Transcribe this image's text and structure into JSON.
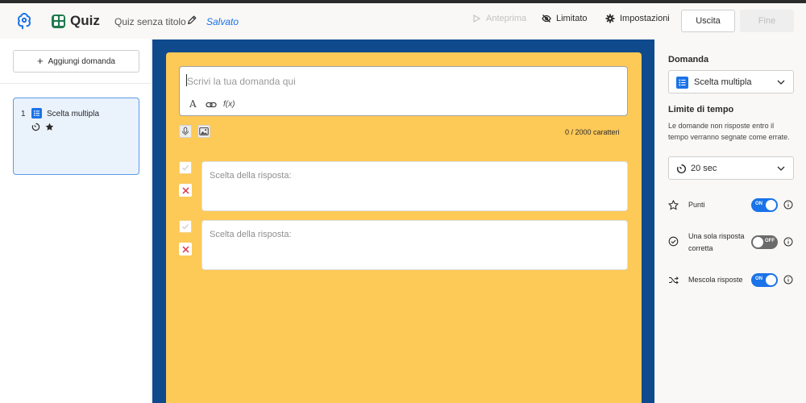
{
  "header": {
    "brand": "Quiz",
    "quiz_title": "Quiz senza titolo",
    "save_status": "Salvato",
    "preview_label": "Anteprima",
    "visibility_label": "Limitato",
    "settings_label": "Impostazioni",
    "exit_label": "Uscita",
    "done_label": "Fine"
  },
  "sidebar": {
    "add_question_label": "Aggiungi domanda",
    "questions": [
      {
        "number": "1",
        "type_label": "Scelta multipla"
      }
    ]
  },
  "editor": {
    "question_placeholder": "Scrivi la tua domanda qui",
    "format_text": "A",
    "format_formula": "f(x)",
    "char_count": "0 / 2000 caratteri",
    "answers": [
      {
        "placeholder": "Scelta della risposta:"
      },
      {
        "placeholder": "Scelta della risposta:"
      }
    ]
  },
  "panel": {
    "question_type_heading": "Domanda",
    "question_type_value": "Scelta multipla",
    "time_limit_heading": "Limite di tempo",
    "time_limit_description": "Le domande non risposte entro il tempo verranno segnate come errate.",
    "time_limit_value": "20 sec",
    "options": [
      {
        "label": "Punti",
        "toggle_text": "ON",
        "state": "on"
      },
      {
        "label": "Una sola risposta corretta",
        "toggle_text": "OFF",
        "state": "off"
      },
      {
        "label": "Mescola risposte",
        "toggle_text": "ON",
        "state": "on"
      }
    ]
  },
  "colors": {
    "accent": "#1a73e8",
    "brand_green": "#1f7a4d",
    "frame_blue": "#0e4a8c",
    "canvas_yellow": "#fdc957",
    "wrong_red": "#d9364b"
  },
  "icons": {
    "logo": "brain-logo-icon",
    "edit": "pencil-icon",
    "preview": "play-icon",
    "visibility": "eye-slash-icon",
    "settings": "gear-icon",
    "add": "plus-icon",
    "question_type": "list-icon",
    "timer": "timer-icon",
    "points": "star-icon",
    "single_answer": "check-circle-icon",
    "shuffle": "shuffle-icon",
    "info": "info-icon",
    "mic": "microphone-icon",
    "image": "image-icon",
    "link": "link-icon",
    "correct": "check-icon",
    "wrong": "x-icon",
    "dropdown": "chevron-down-icon"
  }
}
